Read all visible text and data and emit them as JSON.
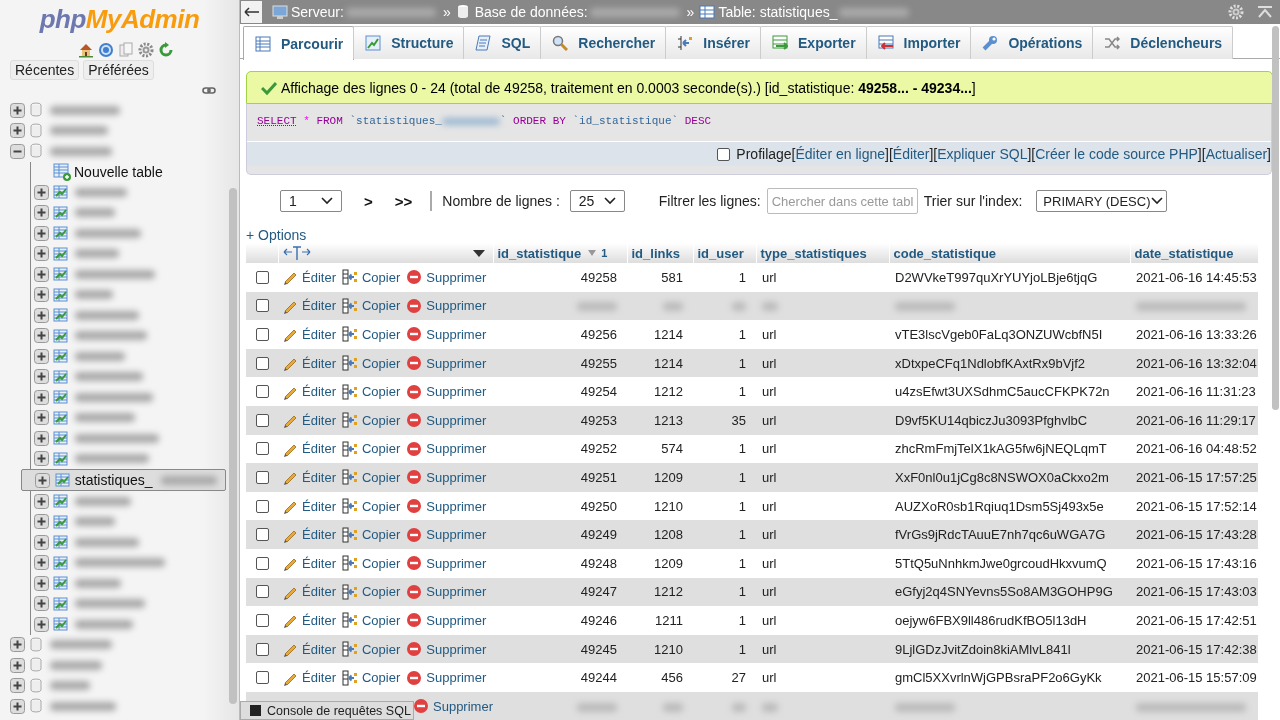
{
  "logo": {
    "part_1": "php",
    "part_2": "MyAdmin"
  },
  "sidebar": {
    "buttons": [
      {
        "label": "Récentes"
      },
      {
        "label": "Préférées"
      }
    ],
    "tree": [
      {
        "kind": "database",
        "expanded": false
      },
      {
        "kind": "database",
        "expanded": false
      },
      {
        "kind": "database",
        "expanded": true,
        "children": [
          {
            "kind": "new",
            "name": "Nouvelle table"
          },
          {
            "kind": "table",
            "selected": false
          },
          {
            "kind": "table",
            "selected": false
          },
          {
            "kind": "table",
            "selected": false
          },
          {
            "kind": "table",
            "selected": false
          },
          {
            "kind": "table",
            "selected": false
          },
          {
            "kind": "table",
            "selected": false
          },
          {
            "kind": "table",
            "selected": false
          },
          {
            "kind": "table",
            "selected": false
          },
          {
            "kind": "table",
            "selected": false
          },
          {
            "kind": "table",
            "selected": false
          },
          {
            "kind": "table",
            "selected": false
          },
          {
            "kind": "table",
            "selected": false
          },
          {
            "kind": "table",
            "selected": false
          },
          {
            "kind": "table",
            "selected": false
          },
          {
            "kind": "table",
            "name": "statistiques_",
            "selected": true
          },
          {
            "kind": "table",
            "selected": false
          },
          {
            "kind": "table",
            "selected": false
          },
          {
            "kind": "table",
            "selected": false
          },
          {
            "kind": "table",
            "selected": false
          },
          {
            "kind": "table",
            "selected": false
          },
          {
            "kind": "table",
            "selected": false
          },
          {
            "kind": "table",
            "selected": false
          }
        ]
      },
      {
        "kind": "database",
        "expanded": false
      },
      {
        "kind": "database",
        "expanded": false
      },
      {
        "kind": "database",
        "expanded": false
      },
      {
        "kind": "database",
        "expanded": false
      }
    ]
  },
  "breadcrumb": [
    {
      "kind": "server",
      "label": "Serveur:"
    },
    {
      "kind": "separator",
      "label": "»"
    },
    {
      "kind": "database",
      "label": "Base de données:"
    },
    {
      "kind": "separator",
      "label": "»"
    },
    {
      "kind": "table",
      "label": "Table: statistiques_"
    }
  ],
  "tabs": [
    {
      "kind": "browse",
      "label": "Parcourir",
      "selected": true
    },
    {
      "kind": "structure",
      "label": "Structure",
      "selected": false
    },
    {
      "kind": "sql",
      "label": "SQL",
      "selected": false
    },
    {
      "kind": "search",
      "label": "Rechercher",
      "selected": false
    },
    {
      "kind": "insert",
      "label": "Insérer",
      "selected": false
    },
    {
      "kind": "export",
      "label": "Exporter",
      "selected": false
    },
    {
      "kind": "import",
      "label": "Importer",
      "selected": false
    },
    {
      "kind": "operations",
      "label": "Opérations",
      "selected": false
    },
    {
      "kind": "triggers",
      "label": "Déclencheurs",
      "selected": false
    }
  ],
  "message": "Affichage des lignes 0 - 24 (total de 49258, traitement en 0.0003 seconde(s).) [id_statistique: **49258... - 49234...**]",
  "query": [
    {
      "kind": "keyword",
      "text": "SELECT"
    },
    {
      "kind": "operator",
      "text": " * "
    },
    {
      "kind": "keyword",
      "text": "FROM"
    },
    {
      "kind": "identifier",
      "text": " `statistiques_"
    },
    {
      "kind": "redacted"
    },
    {
      "kind": "identifier",
      "text": "` "
    },
    {
      "kind": "keyword",
      "text": "ORDER BY"
    },
    {
      "kind": "identifier",
      "text": " `id_statistique` "
    },
    {
      "kind": "keyword",
      "text": "DESC"
    }
  ],
  "query_links": {
    "profiling": {
      "label": "Profilage",
      "checked": false
    },
    "links": [
      {
        "open": "[",
        "label": "Éditer en ligne",
        "close": "]"
      },
      {
        "open": "[ ",
        "label": "Éditer",
        "close": " ]"
      },
      {
        "open": "[ ",
        "label": "Expliquer SQL",
        "close": " ]"
      },
      {
        "open": "[ ",
        "label": "Créer le code source PHP",
        "close": " ]"
      },
      {
        "open": "[ ",
        "label": "Actualiser",
        "close": "]"
      }
    ]
  },
  "navigation": {
    "page": "1",
    "next": ">",
    "last": ">>",
    "rows_label": "Nombre de lignes :",
    "rows": "25",
    "filter_label": "Filtrer les lignes:",
    "filter_placeholder": "Chercher dans cette tabl",
    "sort_label": "Trier sur l'index:",
    "sort": "PRIMARY (DESC)"
  },
  "options_link": "+ Options",
  "table": {
    "columns": [
      {
        "label": "id_statistique",
        "numeric": true,
        "sort_descending": true,
        "sort_index": "1"
      },
      {
        "label": "id_links",
        "numeric": true
      },
      {
        "label": "id_user",
        "numeric": true
      },
      {
        "label": "type_statistiques",
        "numeric": false
      },
      {
        "label": "code_statistique",
        "numeric": false
      },
      {
        "label": "date_statistique",
        "numeric": false
      }
    ],
    "rows": [
      {
        "checked": false,
        "actions": [
          {
            "kind": "edit",
            "label": "Éditer"
          },
          {
            "kind": "copy",
            "label": "Copier"
          },
          {
            "kind": "delete",
            "label": "Supprimer"
          }
        ],
        "cells": [
          "49258",
          "581",
          "1",
          "url",
          "D2WVkeT997quXrYUYjoLBje6tjqG",
          "2021-06-16 14:45:53"
        ]
      },
      {
        "checked": false,
        "redacted": true,
        "actions": [
          {
            "kind": "edit",
            "label": "Éditer"
          },
          {
            "kind": "copy",
            "label": "Copier"
          },
          {
            "kind": "delete",
            "label": "Supprimer"
          }
        ]
      },
      {
        "checked": false,
        "actions": [
          {
            "kind": "edit",
            "label": "Éditer"
          },
          {
            "kind": "copy",
            "label": "Copier"
          },
          {
            "kind": "delete",
            "label": "Supprimer"
          }
        ],
        "cells": [
          "49256",
          "1214",
          "1",
          "url",
          "vTE3lscVgeb0FaLq3ONZUWcbfN5I",
          "2021-06-16 13:33:26"
        ]
      },
      {
        "checked": false,
        "actions": [
          {
            "kind": "edit",
            "label": "Éditer"
          },
          {
            "kind": "copy",
            "label": "Copier"
          },
          {
            "kind": "delete",
            "label": "Supprimer"
          }
        ],
        "cells": [
          "49255",
          "1214",
          "1",
          "url",
          "xDtxpeCFq1NdlobfKAxtRx9bVjf2",
          "2021-06-16 13:32:04"
        ]
      },
      {
        "checked": false,
        "actions": [
          {
            "kind": "edit",
            "label": "Éditer"
          },
          {
            "kind": "copy",
            "label": "Copier"
          },
          {
            "kind": "delete",
            "label": "Supprimer"
          }
        ],
        "cells": [
          "49254",
          "1212",
          "1",
          "url",
          "u4zsEfwt3UXSdhmC5aucCFKPK72n",
          "2021-06-16 11:31:23"
        ]
      },
      {
        "checked": false,
        "actions": [
          {
            "kind": "edit",
            "label": "Éditer"
          },
          {
            "kind": "copy",
            "label": "Copier"
          },
          {
            "kind": "delete",
            "label": "Supprimer"
          }
        ],
        "cells": [
          "49253",
          "1213",
          "35",
          "url",
          "D9vf5KU14qbiczJu3093PfghvlbC",
          "2021-06-16 11:29:17"
        ]
      },
      {
        "checked": false,
        "actions": [
          {
            "kind": "edit",
            "label": "Éditer"
          },
          {
            "kind": "copy",
            "label": "Copier"
          },
          {
            "kind": "delete",
            "label": "Supprimer"
          }
        ],
        "cells": [
          "49252",
          "574",
          "1",
          "url",
          "zhcRmFmjTelX1kAG5fw6jNEQLqmT",
          "2021-06-16 04:48:52"
        ]
      },
      {
        "checked": false,
        "actions": [
          {
            "kind": "edit",
            "label": "Éditer"
          },
          {
            "kind": "copy",
            "label": "Copier"
          },
          {
            "kind": "delete",
            "label": "Supprimer"
          }
        ],
        "cells": [
          "49251",
          "1209",
          "1",
          "url",
          "XxF0nl0u1jCg8c8NSWOX0aCkxo2m",
          "2021-06-15 17:57:25"
        ]
      },
      {
        "checked": false,
        "actions": [
          {
            "kind": "edit",
            "label": "Éditer"
          },
          {
            "kind": "copy",
            "label": "Copier"
          },
          {
            "kind": "delete",
            "label": "Supprimer"
          }
        ],
        "cells": [
          "49250",
          "1210",
          "1",
          "url",
          "AUZXoR0sb1Rqiuq1Dsm5Sj493x5e",
          "2021-06-15 17:52:14"
        ]
      },
      {
        "checked": false,
        "actions": [
          {
            "kind": "edit",
            "label": "Éditer"
          },
          {
            "kind": "copy",
            "label": "Copier"
          },
          {
            "kind": "delete",
            "label": "Supprimer"
          }
        ],
        "cells": [
          "49249",
          "1208",
          "1",
          "url",
          "fVrGs9jRdcTAuuE7nh7qc6uWGA7G",
          "2021-06-15 17:43:28"
        ]
      },
      {
        "checked": false,
        "actions": [
          {
            "kind": "edit",
            "label": "Éditer"
          },
          {
            "kind": "copy",
            "label": "Copier"
          },
          {
            "kind": "delete",
            "label": "Supprimer"
          }
        ],
        "cells": [
          "49248",
          "1209",
          "1",
          "url",
          "5TtQ5uNnhkmJwe0grcoudHkxvumQ",
          "2021-06-15 17:43:16"
        ]
      },
      {
        "checked": false,
        "actions": [
          {
            "kind": "edit",
            "label": "Éditer"
          },
          {
            "kind": "copy",
            "label": "Copier"
          },
          {
            "kind": "delete",
            "label": "Supprimer"
          }
        ],
        "cells": [
          "49247",
          "1212",
          "1",
          "url",
          "eGfyj2q4SNYevns5So8AM3GOHP9G",
          "2021-06-15 17:43:03"
        ]
      },
      {
        "checked": false,
        "actions": [
          {
            "kind": "edit",
            "label": "Éditer"
          },
          {
            "kind": "copy",
            "label": "Copier"
          },
          {
            "kind": "delete",
            "label": "Supprimer"
          }
        ],
        "cells": [
          "49246",
          "1211",
          "1",
          "url",
          "oejyw6FBX9ll486rudKfBO5l13dH",
          "2021-06-15 17:42:51"
        ]
      },
      {
        "checked": false,
        "actions": [
          {
            "kind": "edit",
            "label": "Éditer"
          },
          {
            "kind": "copy",
            "label": "Copier"
          },
          {
            "kind": "delete",
            "label": "Supprimer"
          }
        ],
        "cells": [
          "49245",
          "1210",
          "1",
          "url",
          "9LjlGDzJvitZdoin8kiAMlvL841l",
          "2021-06-15 17:42:38"
        ]
      },
      {
        "checked": false,
        "actions": [
          {
            "kind": "edit",
            "label": "Éditer"
          },
          {
            "kind": "copy",
            "label": "Copier"
          },
          {
            "kind": "delete",
            "label": "Supprimer"
          }
        ],
        "cells": [
          "49244",
          "456",
          "27",
          "url",
          "gmCl5XXvrlnWjGPBsraPF2o6GyKk",
          "2021-06-15 15:57:09"
        ]
      },
      {
        "redacted": true,
        "actions": [
          {
            "kind": "delete",
            "label": "Supprimer"
          }
        ]
      }
    ]
  },
  "console": {
    "label": "Console de requêtes SQL"
  }
}
